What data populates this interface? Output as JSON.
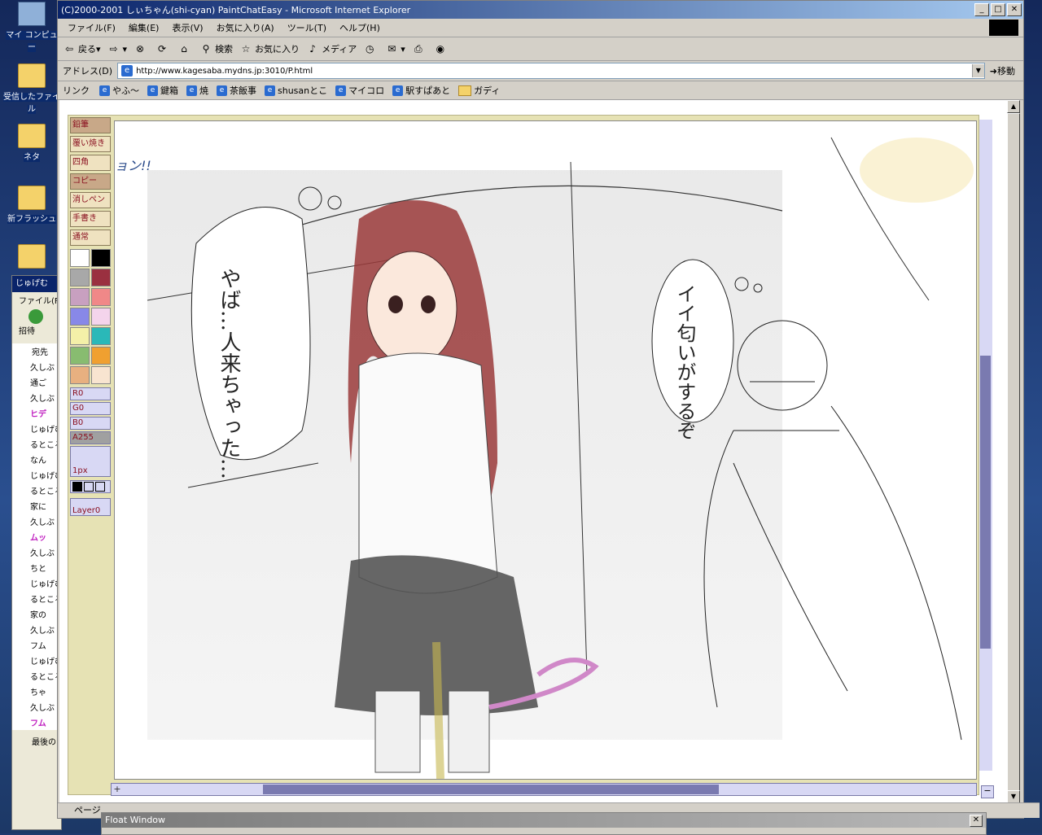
{
  "desktop": {
    "icons": [
      {
        "label": "マイ コンピュー"
      },
      {
        "label": "受信したファイル"
      },
      {
        "label": "ネタ"
      },
      {
        "label": "新フラッシュ"
      }
    ]
  },
  "messenger": {
    "title": "じゅげむ",
    "menu": "ファイル(F",
    "invite": "招待",
    "to_label": "宛先",
    "lines": [
      "久しぶ",
      "通ご",
      "久しぶ",
      "ヒデ",
      "じゅげむ",
      "るところ",
      "なん",
      "じゅげむ",
      "るところ",
      "家に",
      "久しぶ",
      "ムッ",
      "久しぶ",
      "ちと",
      "じゅげむ",
      "るところ",
      "家の",
      "久しぶ",
      "フム",
      "じゅげむ",
      "るところ",
      "ちゃ",
      "久しぶ",
      "フム"
    ],
    "bottom": "最後の"
  },
  "window": {
    "title": "(C)2000-2001 しぃちゃん(shi-cyan) PaintChatEasy - Microsoft Internet Explorer",
    "menu": [
      "ファイル(F)",
      "編集(E)",
      "表示(V)",
      "お気に入り(A)",
      "ツール(T)",
      "ヘルプ(H)"
    ],
    "toolbar": {
      "back": "戻る",
      "search": "検索",
      "favorites": "お気に入り",
      "media": "メディア"
    },
    "address_label": "アドレス(D)",
    "address": "http://www.kagesaba.mydns.jp:3010/P.html",
    "go_label": "移動",
    "links_label": "リンク",
    "links": [
      "やふ～",
      "鍵箱",
      "焼",
      "茶飯事",
      "shusanとこ",
      "マイコロ",
      "駅すぱあと",
      "ガディ"
    ],
    "status": "ページ"
  },
  "paint": {
    "tools": [
      "鉛筆",
      "覆い焼き",
      "四角",
      "コピー",
      "消しペン",
      "手書き",
      "通常"
    ],
    "palette": [
      "#ffffff",
      "#000000",
      "#a8a8a8",
      "#9a3040",
      "#c8a0c0",
      "#f08888",
      "#8888e8",
      "#f4d4ec",
      "#f4f0a8",
      "#2ab8b8",
      "#88bc70",
      "#f0a030",
      "#e8b080",
      "#f8e4d0"
    ],
    "rgb": {
      "r": "R0",
      "g": "G0",
      "b": "B0",
      "a": "A255"
    },
    "size": "1px",
    "layer": "Layer0",
    "speech1": "やば…人来ちゃった…",
    "speech2": "イイ匂いがするぞ",
    "sfx": "ョン!!"
  },
  "floatwin": {
    "title": "Float Window"
  }
}
